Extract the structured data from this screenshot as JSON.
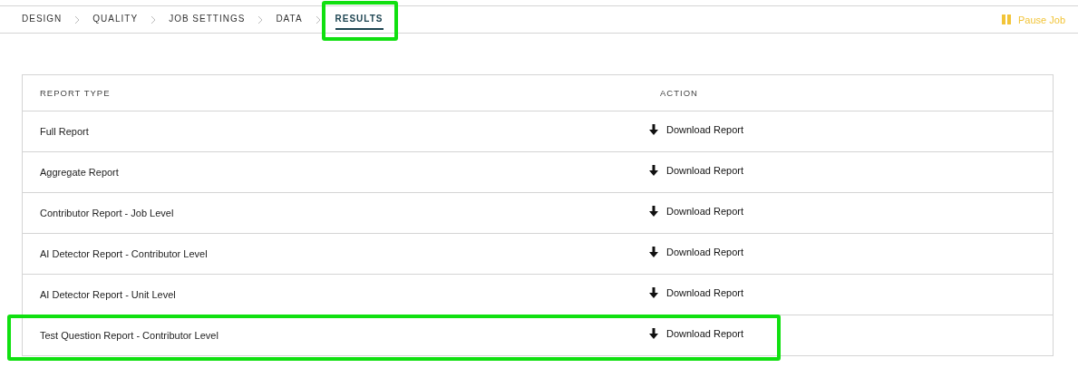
{
  "steps": [
    {
      "label": "DESIGN",
      "selected": false,
      "highlighted": false
    },
    {
      "label": "QUALITY",
      "selected": false,
      "highlighted": false
    },
    {
      "label": "JOB SETTINGS",
      "selected": false,
      "highlighted": false
    },
    {
      "label": "DATA",
      "selected": false,
      "highlighted": false
    },
    {
      "label": "RESULTS",
      "selected": true,
      "highlighted": true
    }
  ],
  "pause_button": {
    "label": "Pause Job"
  },
  "table": {
    "columns": [
      "REPORT TYPE",
      "ACTION"
    ],
    "rows": [
      {
        "report_type": "Full Report",
        "action": "Download Report",
        "highlighted": false
      },
      {
        "report_type": "Aggregate Report",
        "action": "Download Report",
        "highlighted": false
      },
      {
        "report_type": "Contributor Report - Job Level",
        "action": "Download Report",
        "highlighted": false
      },
      {
        "report_type": "AI Detector Report - Contributor Level",
        "action": "Download Report",
        "highlighted": false
      },
      {
        "report_type": "AI Detector Report - Unit Level",
        "action": "Download Report",
        "highlighted": false
      },
      {
        "report_type": "Test Question Report - Contributor Level",
        "action": "Download Report",
        "highlighted": true
      }
    ]
  }
}
